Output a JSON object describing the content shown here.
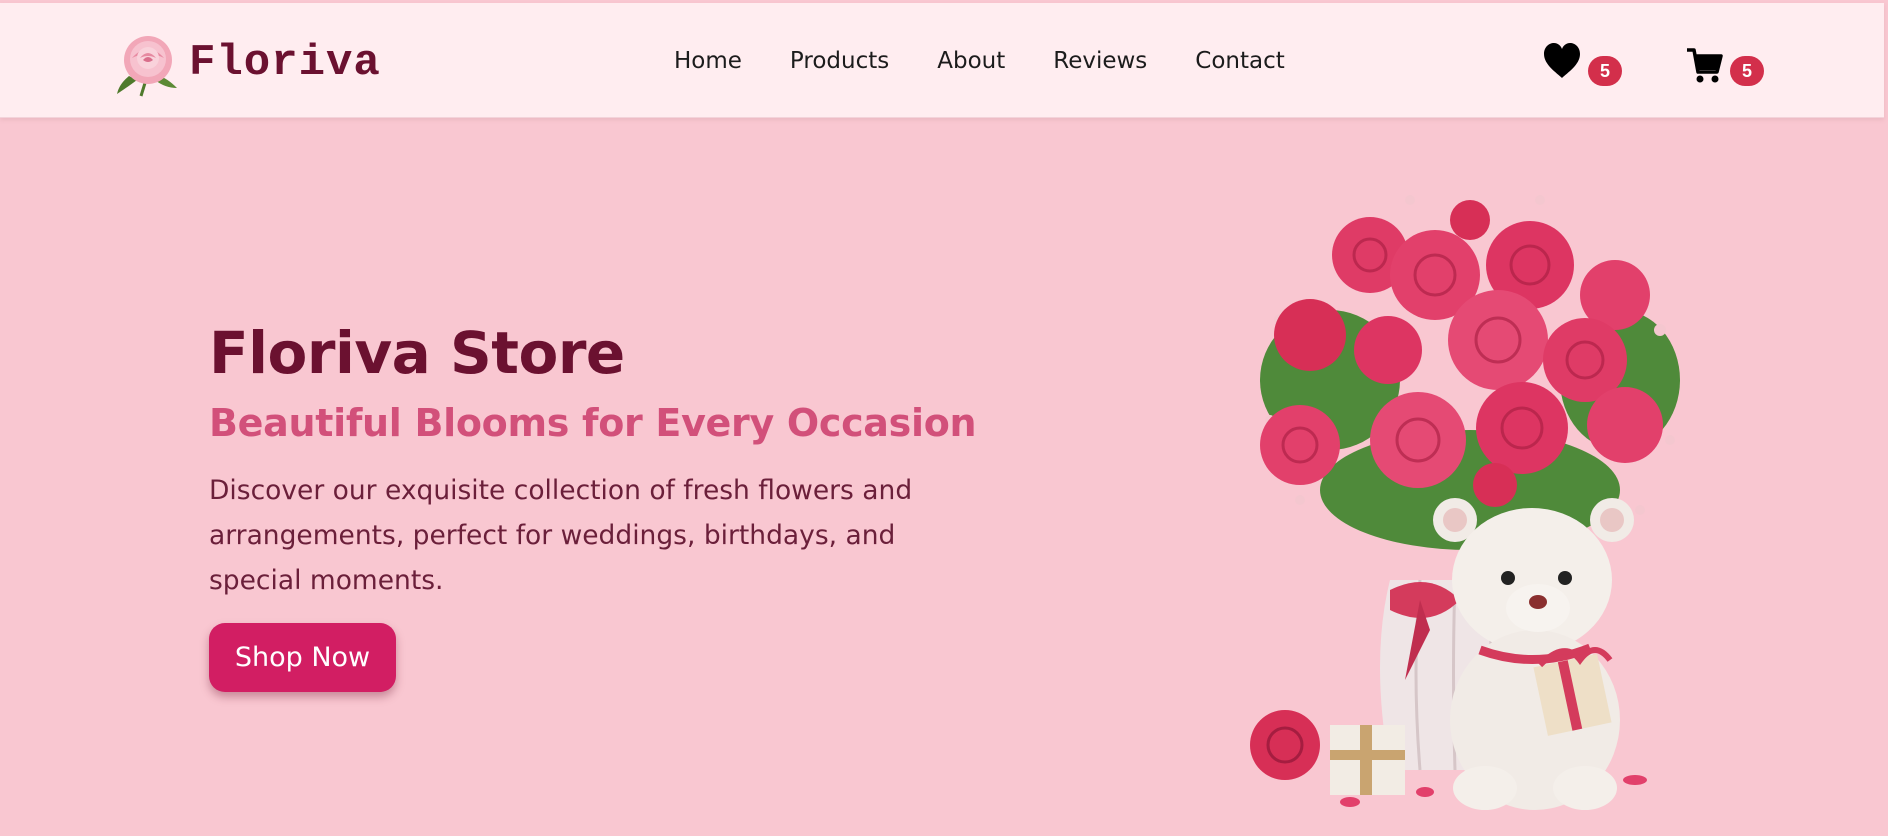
{
  "header": {
    "brand": "Floriva",
    "logo_icon": "rose-icon",
    "nav": [
      {
        "label": "Home"
      },
      {
        "label": "Products"
      },
      {
        "label": "About"
      },
      {
        "label": "Reviews"
      },
      {
        "label": "Contact"
      }
    ],
    "wishlist": {
      "icon": "heart-icon",
      "count": "5"
    },
    "cart": {
      "icon": "cart-icon",
      "count": "5"
    }
  },
  "hero": {
    "title": "Floriva Store",
    "subtitle": "Beautiful Blooms for Every Occasion",
    "description": "Discover our exquisite collection of fresh flowers and arrangements, perfect for weddings, birthdays, and special moments.",
    "cta_label": "Shop Now",
    "image": "rose-bouquet-with-teddy-bear-illustration"
  },
  "colors": {
    "page_bg": "#f9c7d1",
    "header_bg": "#ffedf0",
    "brand": "#6b1130",
    "subtitle": "#d2507a",
    "cta_bg": "#d21e63",
    "badge": "#d32f4b"
  }
}
